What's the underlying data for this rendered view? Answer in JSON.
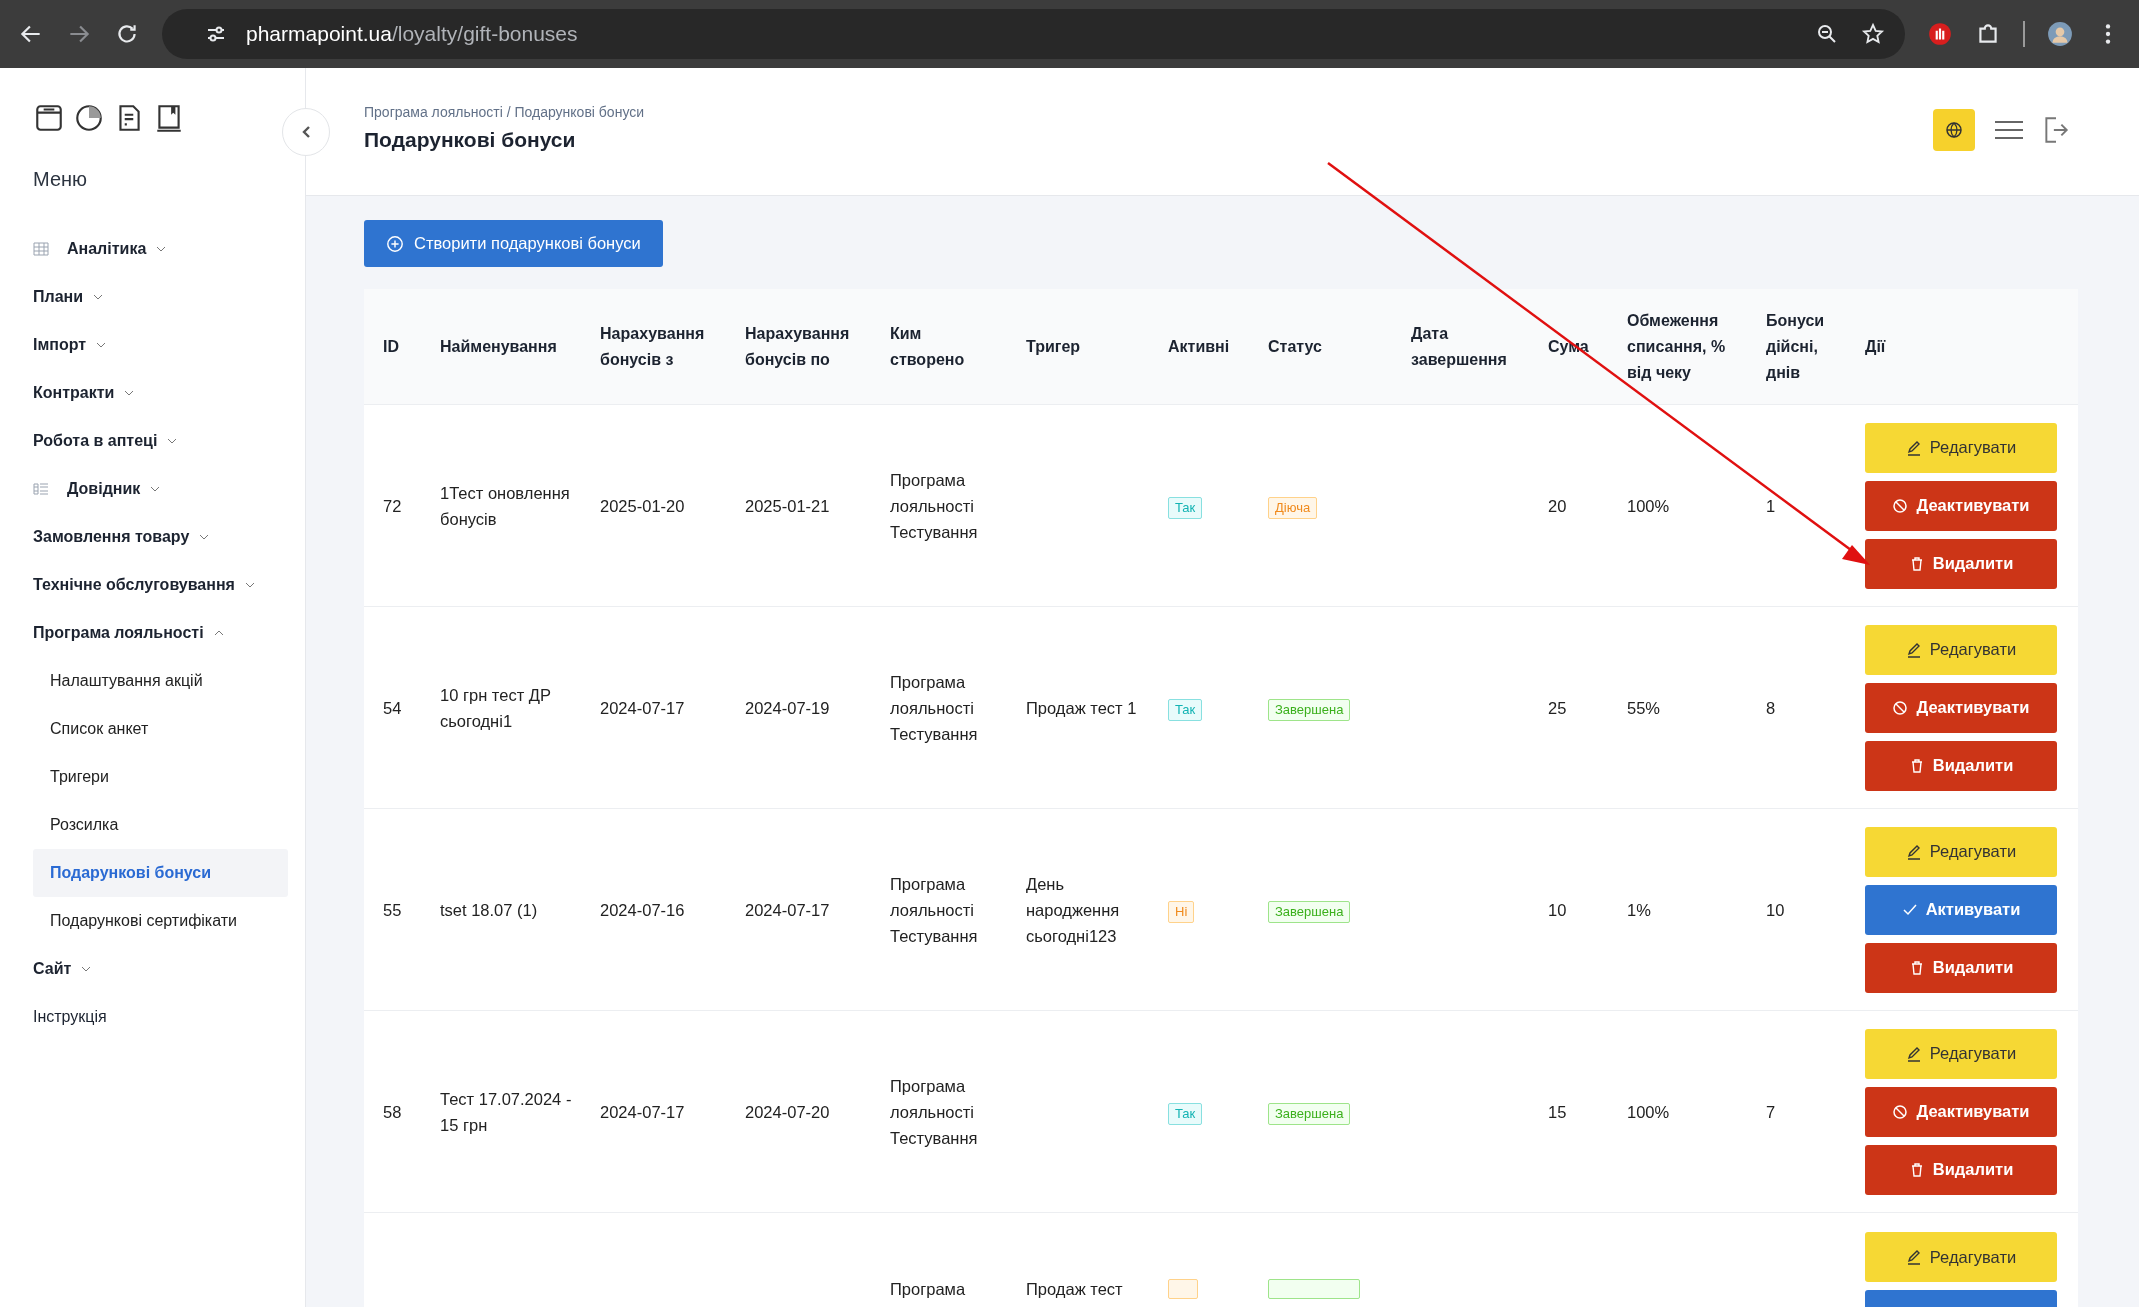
{
  "browser": {
    "host": "pharmapoint.ua",
    "path": "/loyalty/gift-bonuses"
  },
  "sidebar": {
    "title": "Меню",
    "items": [
      {
        "label": "Аналітика",
        "kind": "grid",
        "expanded": false
      },
      {
        "label": "Плани",
        "kind": "plain",
        "expanded": false
      },
      {
        "label": "Імпорт",
        "kind": "plain",
        "expanded": false
      },
      {
        "label": "Контракти",
        "kind": "plain",
        "expanded": false
      },
      {
        "label": "Робота в аптеці",
        "kind": "plain",
        "expanded": false
      },
      {
        "label": "Довідник",
        "kind": "list",
        "expanded": false
      },
      {
        "label": "Замовлення товару",
        "kind": "plain",
        "expanded": false
      },
      {
        "label": "Технічне обслуговування",
        "kind": "plain",
        "expanded": false
      },
      {
        "label": "Програма лояльності",
        "kind": "plain",
        "expanded": true,
        "children": [
          {
            "label": "Налаштування акцій",
            "selected": false
          },
          {
            "label": "Список анкет",
            "selected": false
          },
          {
            "label": "Тригери",
            "selected": false
          },
          {
            "label": "Розсилка",
            "selected": false
          },
          {
            "label": "Подарункові бонуси",
            "selected": true
          },
          {
            "label": "Подарункові сертифікати",
            "selected": false
          }
        ]
      },
      {
        "label": "Сайт",
        "kind": "plain",
        "expanded": false
      },
      {
        "label": "Інструкція",
        "kind": "link"
      }
    ]
  },
  "header": {
    "breadcrumb": "Програма лояльності / Подарункові бонуси",
    "title": "Подарункові бонуси"
  },
  "create_button": "Створити подарункові бонуси",
  "table": {
    "columns": [
      "ID",
      "Найменування",
      "Нарахування бонусів з",
      "Нарахування бонусів по",
      "Ким створено",
      "Тригер",
      "Активні",
      "Статус",
      "Дата завершення",
      "Сума",
      "Обмеження списання, % від чеку",
      "Бонуси дійсні, днів",
      "Дії"
    ],
    "rows": [
      {
        "id": "72",
        "name": "1Тест оновлення бонусів",
        "from": "2025-01-20",
        "to": "2025-01-21",
        "created": "Програма лояльності Тестування",
        "active": {
          "label": "Так",
          "on": true
        },
        "status": {
          "label": "Діюча",
          "kind": "running"
        },
        "sum": "20",
        "limit": "100%",
        "valid": "1",
        "actions": [
          {
            "kind": "edit",
            "label": "Редагувати"
          },
          {
            "kind": "deactivate",
            "label": "Деактивувати"
          },
          {
            "kind": "delete",
            "label": "Видалити"
          }
        ]
      },
      {
        "id": "54",
        "name": "10 грн тест ДР сьогодні1",
        "from": "2024-07-17",
        "to": "2024-07-19",
        "created": "Програма лояльності Тестування",
        "trigger": "Продаж тест 1",
        "active": {
          "label": "Так",
          "on": true
        },
        "status": {
          "label": "Завершена",
          "kind": "done"
        },
        "sum": "25",
        "limit": "55%",
        "valid": "8",
        "actions": [
          {
            "kind": "edit",
            "label": "Редагувати"
          },
          {
            "kind": "deactivate",
            "label": "Деактивувати"
          },
          {
            "kind": "delete",
            "label": "Видалити"
          }
        ]
      },
      {
        "id": "55",
        "name": "tset 18.07 (1)",
        "from": "2024-07-16",
        "to": "2024-07-17",
        "created": "Програма лояльності Тестування",
        "trigger": "День народження сьогодні123",
        "active": {
          "label": "Ні",
          "on": false
        },
        "status": {
          "label": "Завершена",
          "kind": "done"
        },
        "sum": "10",
        "limit": "1%",
        "valid": "10",
        "actions": [
          {
            "kind": "edit",
            "label": "Редагувати"
          },
          {
            "kind": "activate",
            "label": "Активувати"
          },
          {
            "kind": "delete",
            "label": "Видалити"
          }
        ]
      },
      {
        "id": "58",
        "name": "Тест 17.07.2024 - 15 грн",
        "from": "2024-07-17",
        "to": "2024-07-20",
        "created": "Програма лояльності Тестування",
        "active": {
          "label": "Так",
          "on": true
        },
        "status": {
          "label": "Завершена",
          "kind": "done"
        },
        "sum": "15",
        "limit": "100%",
        "valid": "7",
        "actions": [
          {
            "kind": "edit",
            "label": "Редагувати"
          },
          {
            "kind": "deactivate",
            "label": "Деактивувати"
          },
          {
            "kind": "delete",
            "label": "Видалити"
          }
        ]
      },
      {
        "created": "Програма",
        "trigger": "Продаж тест",
        "active": {
          "on": false
        },
        "status": {
          "kind": "done"
        },
        "actions": [
          {
            "kind": "edit",
            "label": "Редагувати"
          },
          {
            "kind": "activate"
          }
        ]
      }
    ]
  }
}
